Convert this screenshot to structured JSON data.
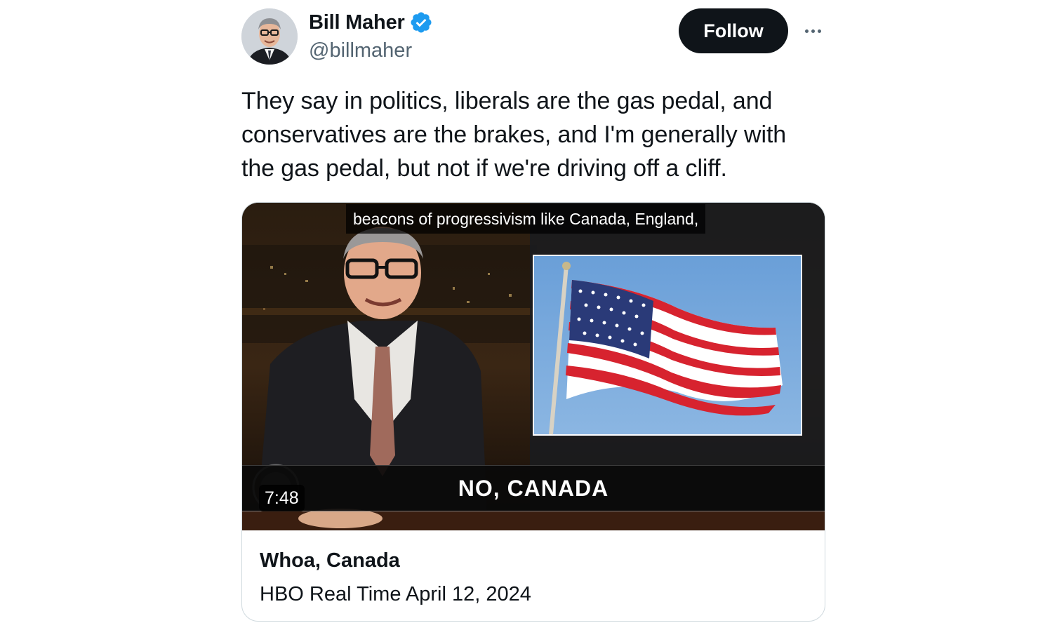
{
  "author": {
    "display_name": "Bill Maher",
    "handle": "@billmaher",
    "verified_icon": "verified-badge-icon",
    "avatar_icon": "avatar"
  },
  "actions": {
    "follow_label": "Follow",
    "more_icon": "more-horizontal-icon"
  },
  "tweet": {
    "text": "They say in politics, liberals are the gas pedal, and conservatives are the brakes, and I'm generally with the gas pedal, but not if we're driving off a cliff."
  },
  "media": {
    "caption": "beacons of progressivism like Canada, England,",
    "banner": "NO, CANADA",
    "duration": "7:48",
    "card_title": "Whoa, Canada",
    "card_subtitle": "HBO Real Time April 12, 2024"
  },
  "colors": {
    "text_primary": "#0f1419",
    "text_secondary": "#536471",
    "verified_blue": "#1d9bf0",
    "follow_bg": "#0f1419",
    "card_border": "#cfd9de"
  }
}
